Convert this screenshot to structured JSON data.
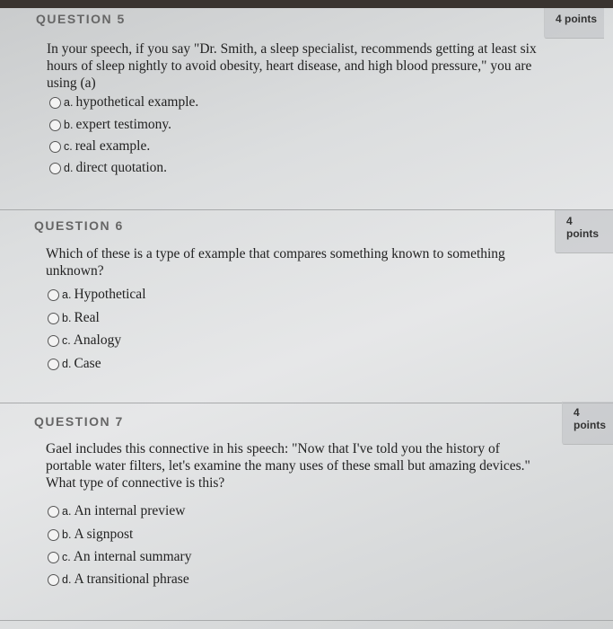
{
  "questions": [
    {
      "header": "QUESTION 5",
      "points": "4 points",
      "text_lines": [
        "In your speech, if you say \"Dr. Smith, a sleep specialist, recommends getting at least six",
        "hours of sleep nightly to avoid obesity, heart disease, and high blood pressure,\" you are",
        "using (a)"
      ],
      "options": [
        {
          "letter": "a.",
          "label": "hypothetical example.",
          "selected": false
        },
        {
          "letter": "b.",
          "label": "expert testimony.",
          "selected": false
        },
        {
          "letter": "c.",
          "label": "real example.",
          "selected": false
        },
        {
          "letter": "d.",
          "label": "direct quotation.",
          "selected": false
        }
      ]
    },
    {
      "header": "QUESTION 6",
      "points": "4 points",
      "text_lines": [
        "Which of these is a type of example that compares something known to something",
        "unknown?"
      ],
      "options": [
        {
          "letter": "a.",
          "label": "Hypothetical",
          "selected": false
        },
        {
          "letter": "b.",
          "label": "Real",
          "selected": false
        },
        {
          "letter": "c.",
          "label": "Analogy",
          "selected": false
        },
        {
          "letter": "d.",
          "label": "Case",
          "selected": false
        }
      ]
    },
    {
      "header": "QUESTION 7",
      "points": "4 points",
      "text_lines": [
        "Gael includes this connective in his speech: \"Now that I've told you the history of",
        "portable water filters, let's examine the many uses of these small but amazing devices.\"",
        "What type of connective is this?"
      ],
      "options": [
        {
          "letter": "a.",
          "label": "An internal preview",
          "selected": false
        },
        {
          "letter": "b.",
          "label": "A signpost",
          "selected": false
        },
        {
          "letter": "c.",
          "label": "An internal summary",
          "selected": false
        },
        {
          "letter": "d.",
          "label": "A transitional phrase",
          "selected": false
        }
      ]
    }
  ]
}
